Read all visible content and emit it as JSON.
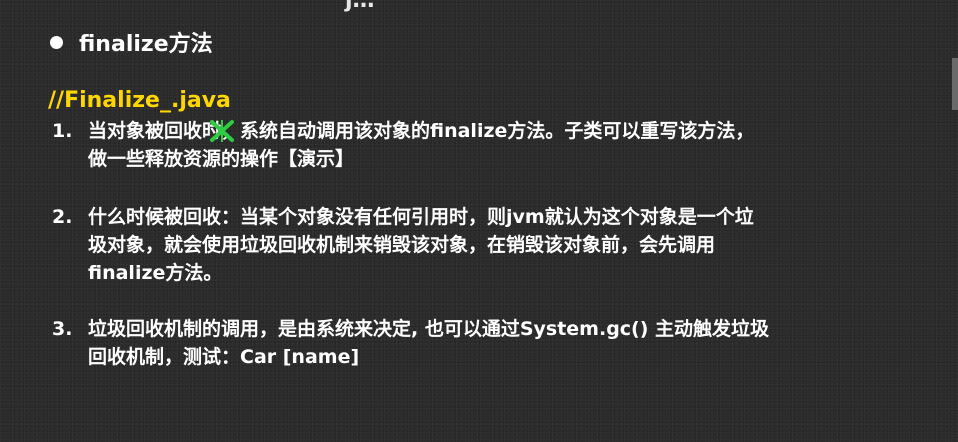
{
  "top_cutoff_text": "j…",
  "heading": "finalize方法",
  "file_comment": "//Finalize_.java",
  "items": [
    {
      "number": "1.",
      "lines": [
        "当对象被回收时，系统自动调用该对象的finalize方法。子类可以重写该方法，",
        "做一些释放资源的操作【演示】"
      ]
    },
    {
      "number": "2.",
      "lines": [
        "什么时候被回收：当某个对象没有任何引用时，则jvm就认为这个对象是一个垃",
        "圾对象，就会使用垃圾回收机制来销毁该对象，在销毁该对象前，会先调用",
        "finalize方法。"
      ]
    },
    {
      "number": "3.",
      "lines": [
        "垃圾回收机制的调用，是由系统来决定, 也可以通过System.gc() 主动触发垃圾",
        "回收机制，测试：Car [name]"
      ]
    }
  ],
  "cursor_icon": "text-select-cursor-icon",
  "colors": {
    "background": "#2b2b2b",
    "text": "#ffffff",
    "highlight": "#ffd700",
    "cursor": "#2ecc40"
  }
}
